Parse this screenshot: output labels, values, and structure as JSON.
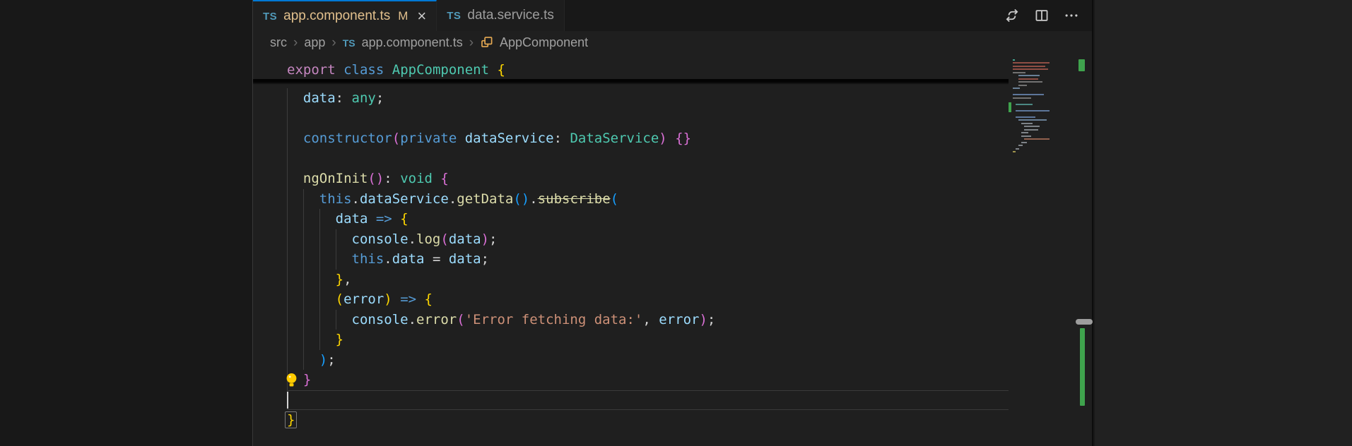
{
  "colors": {
    "shell_bg": "#181818",
    "editor_bg": "#1f1f1f",
    "right_panel_bg": "#212121",
    "accent_blue": "#0078d4",
    "tab_modified": "#e2c08d",
    "tab_inactive_fg": "#9d9d9d",
    "breadcrumb_fg": "#a0a0a0",
    "icon_fg": "#cccccc",
    "ts_icon_blue": "#519aba",
    "class_icon_orange": "#e8ab53",
    "tok_control": "#c586c0",
    "tok_keyword": "#569cd6",
    "tok_type": "#4ec9b0",
    "tok_var": "#9cdcfe",
    "tok_fn": "#dcdcaa",
    "tok_str": "#ce9178",
    "tok_default": "#d4d4d4",
    "bracket1": "#ffd700",
    "bracket2": "#da70d6",
    "bracket3": "#179fff",
    "guide": "#3c3c3c",
    "line_highlight_border": "#3a3a3a",
    "cursor": "#d4d4d4",
    "git_added_green": "#3fa34d",
    "lightbulb_yellow": "#ffcc00"
  },
  "tabs": [
    {
      "icon": "TS",
      "label": "app.component.ts",
      "badge": "M",
      "close_glyph": "×",
      "active": true
    },
    {
      "icon": "TS",
      "label": "data.service.ts",
      "badge": "",
      "close_glyph": "",
      "active": false
    }
  ],
  "editor_actions": [
    {
      "name": "open-changes"
    },
    {
      "name": "split-editor"
    },
    {
      "name": "more-actions",
      "glyph": "⋯"
    }
  ],
  "breadcrumb": {
    "separator": "›",
    "items": [
      "src",
      "app"
    ],
    "file_icon": "TS",
    "file": "app.component.ts",
    "symbol_icon": "class",
    "symbol": "AppComponent"
  },
  "editor": {
    "sticky_line": {
      "tokens": [
        [
          "kc",
          "export"
        ],
        [
          "d",
          " "
        ],
        [
          "k",
          "class"
        ],
        [
          "d",
          " "
        ],
        [
          "t",
          "AppComponent"
        ],
        [
          "d",
          " "
        ],
        [
          "b1",
          "{"
        ]
      ]
    },
    "cursor": {
      "line": 16,
      "col": 0
    },
    "deprecated_symbol": "subscribe",
    "lines": [
      {
        "tokens": [
          [
            "ws",
            "  "
          ],
          [
            "v",
            "data"
          ],
          [
            "d",
            ": "
          ],
          [
            "t",
            "any"
          ],
          [
            "d",
            ";"
          ]
        ],
        "guides": [
          0
        ]
      },
      {
        "tokens": [],
        "guides": [
          0
        ]
      },
      {
        "tokens": [
          [
            "ws",
            "  "
          ],
          [
            "k",
            "constructor"
          ],
          [
            "b2",
            "("
          ],
          [
            "k",
            "private"
          ],
          [
            "d",
            " "
          ],
          [
            "v",
            "dataService"
          ],
          [
            "d",
            ": "
          ],
          [
            "t",
            "DataService"
          ],
          [
            "b2",
            ")"
          ],
          [
            "d",
            " "
          ],
          [
            "b2",
            "{}"
          ]
        ],
        "guides": [
          0
        ]
      },
      {
        "tokens": [],
        "guides": [
          0
        ]
      },
      {
        "tokens": [
          [
            "ws",
            "  "
          ],
          [
            "f",
            "ngOnInit"
          ],
          [
            "b2",
            "()"
          ],
          [
            "d",
            ": "
          ],
          [
            "t",
            "void"
          ],
          [
            "d",
            " "
          ],
          [
            "b2",
            "{"
          ]
        ],
        "guides": [
          0
        ]
      },
      {
        "tokens": [
          [
            "ws",
            "    "
          ],
          [
            "k",
            "this"
          ],
          [
            "d",
            "."
          ],
          [
            "v",
            "dataService"
          ],
          [
            "d",
            "."
          ],
          [
            "f",
            "getData"
          ],
          [
            "b3",
            "()"
          ],
          [
            "d",
            "."
          ],
          [
            "fs",
            "subscribe"
          ],
          [
            "b3",
            "("
          ]
        ],
        "guides": [
          0,
          2
        ]
      },
      {
        "tokens": [
          [
            "ws",
            "      "
          ],
          [
            "v",
            "data"
          ],
          [
            "d",
            " "
          ],
          [
            "k",
            "=>"
          ],
          [
            "d",
            " "
          ],
          [
            "b1",
            "{"
          ]
        ],
        "guides": [
          0,
          2,
          4
        ]
      },
      {
        "tokens": [
          [
            "ws",
            "        "
          ],
          [
            "v",
            "console"
          ],
          [
            "d",
            "."
          ],
          [
            "f",
            "log"
          ],
          [
            "b2",
            "("
          ],
          [
            "v",
            "data"
          ],
          [
            "b2",
            ")"
          ],
          [
            "d",
            ";"
          ]
        ],
        "guides": [
          0,
          2,
          4,
          6
        ]
      },
      {
        "tokens": [
          [
            "ws",
            "        "
          ],
          [
            "k",
            "this"
          ],
          [
            "d",
            "."
          ],
          [
            "v",
            "data"
          ],
          [
            "d",
            " = "
          ],
          [
            "v",
            "data"
          ],
          [
            "d",
            ";"
          ]
        ],
        "guides": [
          0,
          2,
          4,
          6
        ]
      },
      {
        "tokens": [
          [
            "ws",
            "      "
          ],
          [
            "b1",
            "}"
          ],
          [
            "d",
            ","
          ]
        ],
        "guides": [
          0,
          2,
          4
        ]
      },
      {
        "tokens": [
          [
            "ws",
            "      "
          ],
          [
            "b1",
            "("
          ],
          [
            "v",
            "error"
          ],
          [
            "b1",
            ")"
          ],
          [
            "d",
            " "
          ],
          [
            "k",
            "=>"
          ],
          [
            "d",
            " "
          ],
          [
            "b1",
            "{"
          ]
        ],
        "guides": [
          0,
          2,
          4
        ]
      },
      {
        "tokens": [
          [
            "ws",
            "        "
          ],
          [
            "v",
            "console"
          ],
          [
            "d",
            "."
          ],
          [
            "f",
            "error"
          ],
          [
            "b2",
            "("
          ],
          [
            "s",
            "'Error fetching data:'"
          ],
          [
            "d",
            ", "
          ],
          [
            "v",
            "error"
          ],
          [
            "b2",
            ")"
          ],
          [
            "d",
            ";"
          ]
        ],
        "guides": [
          0,
          2,
          4,
          6
        ]
      },
      {
        "tokens": [
          [
            "ws",
            "      "
          ],
          [
            "b1",
            "}"
          ]
        ],
        "guides": [
          0,
          2,
          4
        ]
      },
      {
        "tokens": [
          [
            "ws",
            "    "
          ],
          [
            "b3",
            ")"
          ],
          [
            "d",
            ";"
          ]
        ],
        "guides": [
          0,
          2
        ]
      },
      {
        "tokens": [
          [
            "ws",
            "  "
          ],
          [
            "b2",
            "}"
          ]
        ],
        "guides": [
          0
        ],
        "lightbulb": true
      },
      {
        "tokens": [],
        "guides": [],
        "current": true
      },
      {
        "tokens": [
          [
            "b1",
            "}"
          ]
        ],
        "guides": [],
        "bracket_match": true
      }
    ]
  },
  "minimap": {
    "marks": [
      [
        84,
        6,
        3,
        "#4ec9b0"
      ],
      [
        88,
        6,
        52,
        "#b05c50"
      ],
      [
        93,
        6,
        46,
        "#b05c50"
      ],
      [
        97,
        6,
        50,
        "#b05c50"
      ],
      [
        102,
        6,
        18,
        "#8a8a8a"
      ],
      [
        106,
        14,
        30,
        "#7f9cb8"
      ],
      [
        111,
        14,
        28,
        "#b05c50"
      ],
      [
        115,
        14,
        34,
        "#8a8a8a"
      ],
      [
        120,
        14,
        12,
        "#8a8a8a"
      ],
      [
        124,
        6,
        10,
        "#7f9cb8"
      ],
      [
        133,
        6,
        44,
        "#6f8fbe"
      ],
      [
        138,
        6,
        26,
        "#8a8a8a"
      ],
      [
        147,
        10,
        24,
        "#58a6a0"
      ],
      [
        156,
        10,
        48,
        "#6f8fbe"
      ],
      [
        165,
        10,
        28,
        "#6f8fbe"
      ],
      [
        169,
        14,
        40,
        "#7f9cb8"
      ],
      [
        174,
        18,
        16,
        "#9aa0a6"
      ],
      [
        178,
        22,
        22,
        "#9aa0a6"
      ],
      [
        183,
        22,
        20,
        "#9aa0a6"
      ],
      [
        187,
        18,
        10,
        "#9aa0a6"
      ],
      [
        192,
        18,
        14,
        "#9aa0a6"
      ],
      [
        196,
        22,
        36,
        "#b3745c"
      ],
      [
        201,
        18,
        8,
        "#9aa0a6"
      ],
      [
        205,
        14,
        6,
        "#9aa0a6"
      ],
      [
        210,
        10,
        5,
        "#9aa0a6"
      ],
      [
        214,
        6,
        4,
        "#c4b65a"
      ]
    ]
  },
  "overview_ruler": {
    "marks": [
      [
        1069,
        145,
        4,
        14,
        "#3fa34d",
        0
      ],
      [
        1168,
        84,
        9,
        17,
        "#3fa34d",
        1
      ],
      [
        1164,
        452,
        24,
        8,
        "#9d9d9d",
        4
      ],
      [
        1170,
        465,
        7,
        110,
        "#3fa34d",
        1
      ]
    ]
  }
}
